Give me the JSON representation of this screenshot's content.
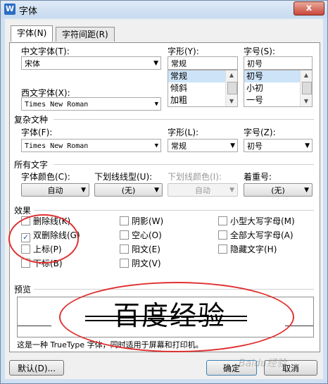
{
  "window": {
    "title": "字体",
    "app_icon": "W",
    "close": "x"
  },
  "tabs": [
    {
      "label": "字体(N)"
    },
    {
      "label": "字符间距(R)"
    }
  ],
  "font": {
    "chinese_label": "中文字体(T):",
    "chinese_value": "宋体",
    "western_label": "西文字体(X):",
    "western_value": "Times New Roman",
    "style_label": "字形(Y):",
    "style_value": "常规",
    "style_items": [
      "常规",
      "倾斜",
      "加粗"
    ],
    "size_label": "字号(S):",
    "size_value": "初号",
    "size_items": [
      "初号",
      "小初",
      "一号"
    ]
  },
  "complex": {
    "section": "复杂文种",
    "font_label": "字体(F):",
    "font_value": "Times New Roman",
    "style_label": "字形(L):",
    "style_value": "常规",
    "size_label": "字号(Z):",
    "size_value": "初号"
  },
  "all_text": {
    "section": "所有文字",
    "color_label": "字体颜色(C):",
    "color_value": "自动",
    "underline_label": "下划线线型(U):",
    "underline_value": "(无)",
    "underline_color_label": "下划线颜色(I):",
    "underline_color_value": "自动",
    "emphasis_label": "着重号:",
    "emphasis_value": "(无)"
  },
  "effects": {
    "section": "效果",
    "items": [
      {
        "label": "删除线(K)",
        "checked": false
      },
      {
        "label": "双删除线(G)",
        "checked": true
      },
      {
        "label": "上标(P)",
        "checked": false
      },
      {
        "label": "下标(B)",
        "checked": false
      },
      {
        "label": "阴影(W)",
        "checked": false
      },
      {
        "label": "空心(O)",
        "checked": false
      },
      {
        "label": "阳文(E)",
        "checked": false
      },
      {
        "label": "阴文(V)",
        "checked": false
      },
      {
        "label": "小型大写字母(M)",
        "checked": false
      },
      {
        "label": "全部大写字母(A)",
        "checked": false
      },
      {
        "label": "隐藏文字(H)",
        "checked": false
      }
    ]
  },
  "preview": {
    "section": "预览",
    "sample": "百度经验",
    "note": "这是一种 TrueType 字体，同时适用于屏幕和打印机。"
  },
  "buttons": {
    "default": "默认(D)...",
    "ok": "确定",
    "cancel": "取消"
  },
  "watermark": "Baidu经验",
  "check_mark": "✓",
  "colors": {
    "annotation_red": "#e03030"
  }
}
